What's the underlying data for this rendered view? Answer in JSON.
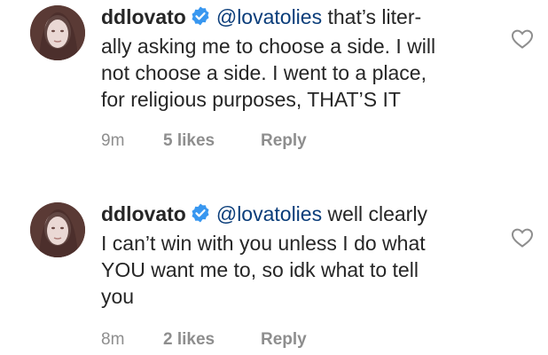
{
  "comments": [
    {
      "username": "ddlovato",
      "mention": "@lovatolies",
      "lines": [
        " that’s liter-",
        "ally asking me to choose a side. I will",
        "not choose a side. I went to a place,",
        "for religious purposes, THAT’S IT"
      ],
      "time": "9m",
      "likes": "5 likes",
      "reply": "Reply"
    },
    {
      "username": "ddlovato",
      "mention": "@lovatolies",
      "lines": [
        " well clearly",
        "I can’t win with you unless I do what",
        "YOU want me to, so idk what to tell",
        "you"
      ],
      "time": "8m",
      "likes": "2 likes",
      "reply": "Reply"
    }
  ],
  "colors": {
    "verified": "#3897f0",
    "mention": "#0a3d7a",
    "meta": "#8e8e8e"
  },
  "icons": {
    "avatar": "avatar",
    "verified": "verified-badge-icon",
    "like": "heart-icon"
  }
}
